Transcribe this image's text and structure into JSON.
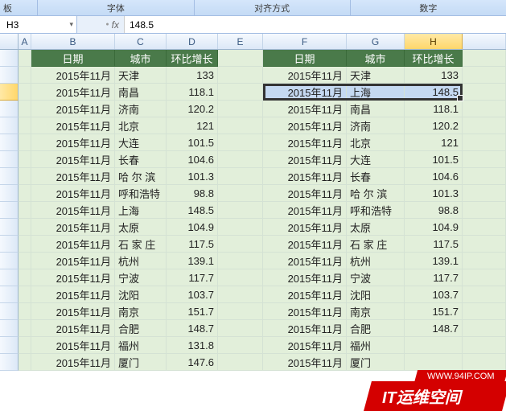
{
  "ribbon": {
    "group_clipboard": "板",
    "group_font": "字体",
    "group_align": "对齐方式",
    "group_number": "数字"
  },
  "formula_bar": {
    "name_box": "H3",
    "fx": "fx",
    "value": "148.5"
  },
  "columns": [
    "A",
    "B",
    "C",
    "D",
    "E",
    "F",
    "G",
    "H"
  ],
  "selected_col": "H",
  "selected_row": 3,
  "table_headers": {
    "date": "日期",
    "city": "城市",
    "ratio": "环比增长"
  },
  "chart_data": {
    "type": "table",
    "title": "",
    "left": {
      "columns": [
        "日期",
        "城市",
        "环比增长"
      ],
      "rows": [
        {
          "date": "2015年11月",
          "city": "天津",
          "ratio": 133
        },
        {
          "date": "2015年11月",
          "city": "南昌",
          "ratio": 118.1
        },
        {
          "date": "2015年11月",
          "city": "济南",
          "ratio": 120.2
        },
        {
          "date": "2015年11月",
          "city": "北京",
          "ratio": 121
        },
        {
          "date": "2015年11月",
          "city": "大连",
          "ratio": 101.5
        },
        {
          "date": "2015年11月",
          "city": "长春",
          "ratio": 104.6
        },
        {
          "date": "2015年11月",
          "city": "哈 尔 滨",
          "ratio": 101.3
        },
        {
          "date": "2015年11月",
          "city": "呼和浩特",
          "ratio": 98.8
        },
        {
          "date": "2015年11月",
          "city": "上海",
          "ratio": 148.5
        },
        {
          "date": "2015年11月",
          "city": "太原",
          "ratio": 104.9
        },
        {
          "date": "2015年11月",
          "city": "石 家 庄",
          "ratio": 117.5
        },
        {
          "date": "2015年11月",
          "city": "杭州",
          "ratio": 139.1
        },
        {
          "date": "2015年11月",
          "city": "宁波",
          "ratio": 117.7
        },
        {
          "date": "2015年11月",
          "city": "沈阳",
          "ratio": 103.7
        },
        {
          "date": "2015年11月",
          "city": "南京",
          "ratio": 151.7
        },
        {
          "date": "2015年11月",
          "city": "合肥",
          "ratio": 148.7
        },
        {
          "date": "2015年11月",
          "city": "福州",
          "ratio": 131.8
        },
        {
          "date": "2015年11月",
          "city": "厦门",
          "ratio": 147.6
        }
      ]
    },
    "right": {
      "columns": [
        "日期",
        "城市",
        "环比增长"
      ],
      "rows": [
        {
          "date": "2015年11月",
          "city": "天津",
          "ratio": 133
        },
        {
          "date": "2015年11月",
          "city": "上海",
          "ratio": 148.5
        },
        {
          "date": "2015年11月",
          "city": "南昌",
          "ratio": 118.1
        },
        {
          "date": "2015年11月",
          "city": "济南",
          "ratio": 120.2
        },
        {
          "date": "2015年11月",
          "city": "北京",
          "ratio": 121
        },
        {
          "date": "2015年11月",
          "city": "大连",
          "ratio": 101.5
        },
        {
          "date": "2015年11月",
          "city": "长春",
          "ratio": 104.6
        },
        {
          "date": "2015年11月",
          "city": "哈 尔 滨",
          "ratio": 101.3
        },
        {
          "date": "2015年11月",
          "city": "呼和浩特",
          "ratio": 98.8
        },
        {
          "date": "2015年11月",
          "city": "太原",
          "ratio": 104.9
        },
        {
          "date": "2015年11月",
          "city": "石 家 庄",
          "ratio": 117.5
        },
        {
          "date": "2015年11月",
          "city": "杭州",
          "ratio": 139.1
        },
        {
          "date": "2015年11月",
          "city": "宁波",
          "ratio": 117.7
        },
        {
          "date": "2015年11月",
          "city": "沈阳",
          "ratio": 103.7
        },
        {
          "date": "2015年11月",
          "city": "南京",
          "ratio": 151.7
        },
        {
          "date": "2015年11月",
          "city": "合肥",
          "ratio": 148.7
        },
        {
          "date": "2015年11月",
          "city": "福州",
          "ratio": ""
        },
        {
          "date": "2015年11月",
          "city": "厦门",
          "ratio": ""
        }
      ]
    }
  },
  "watermark": {
    "url": "WWW.94IP.COM",
    "main": "IT运维空间"
  }
}
